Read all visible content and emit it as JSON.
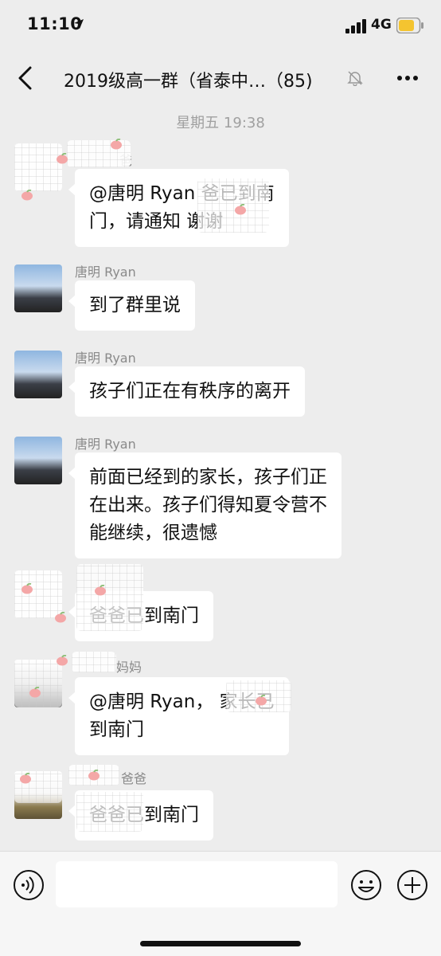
{
  "status_bar": {
    "time": "11:10",
    "network": "4G",
    "icons": [
      "location-arrow-icon",
      "signal-bars-icon",
      "battery-icon"
    ],
    "battery_color": "#f4c430"
  },
  "nav": {
    "back_icon": "chevron-left-icon",
    "title": "2019级高一群（省泰中…（85)",
    "mute_icon": "bell-muted-icon",
    "more_icon": "more-dots-icon"
  },
  "chat": {
    "timestamp": "星期五 19:38",
    "messages": [
      {
        "sender": "爸",
        "lines": [
          "@唐明 Ryan        爸已到南",
          "门，请通知       谢谢"
        ],
        "sender_partly_obscured": true
      },
      {
        "sender": "唐明 Ryan",
        "lines": [
          "到了群里说"
        ]
      },
      {
        "sender": "唐明 Ryan",
        "lines": [
          "孩子们正在有秩序的离开"
        ]
      },
      {
        "sender": "唐明 Ryan",
        "lines": [
          "前面已经到的家长，孩子们正",
          "在出来。孩子们得知夏令营不",
          "能继续，很遗憾"
        ]
      },
      {
        "sender": "",
        "lines": [
          "      爸爸已到南门"
        ],
        "sender_partly_obscured": true
      },
      {
        "sender": "妈妈",
        "lines": [
          "@唐明 Ryan，         家长已",
          "到南门"
        ],
        "sender_partly_obscured": true
      },
      {
        "sender": "爸爸",
        "lines": [
          "      爸爸已到南门"
        ],
        "sender_partly_obscured": true
      }
    ]
  },
  "input_bar": {
    "voice_icon": "voice-icon",
    "emoji_icon": "emoji-icon",
    "plus_icon": "plus-icon",
    "value": ""
  },
  "colors": {
    "background": "#ededed",
    "bubble": "#ffffff",
    "meta_text": "#a0a0a0"
  }
}
